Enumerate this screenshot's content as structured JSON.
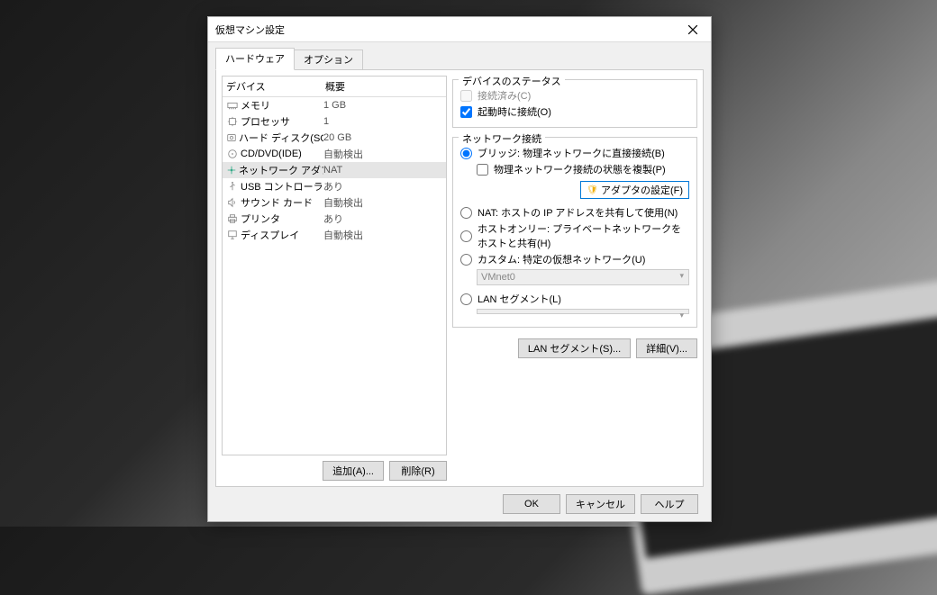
{
  "title": "仮想マシン設定",
  "tabs": {
    "hardware": "ハードウェア",
    "options": "オプション"
  },
  "deviceList": {
    "headers": {
      "device": "デバイス",
      "summary": "概要"
    },
    "rows": [
      {
        "icon": "memory",
        "device": "メモリ",
        "summary": "1 GB"
      },
      {
        "icon": "cpu",
        "device": "プロセッサ",
        "summary": "1"
      },
      {
        "icon": "hdd",
        "device": "ハード ディスク(SCSI)",
        "summary": "20 GB"
      },
      {
        "icon": "cd",
        "device": "CD/DVD(IDE)",
        "summary": "自動検出"
      },
      {
        "icon": "nic",
        "device": "ネットワーク アダプタ",
        "summary": "NAT"
      },
      {
        "icon": "usb",
        "device": "USB コントローラ",
        "summary": "あり"
      },
      {
        "icon": "sound",
        "device": "サウンド カード",
        "summary": "自動検出"
      },
      {
        "icon": "printer",
        "device": "プリンタ",
        "summary": "あり"
      },
      {
        "icon": "display",
        "device": "ディスプレイ",
        "summary": "自動検出"
      }
    ]
  },
  "selectedIndex": 4,
  "hwButtons": {
    "add": "追加(A)...",
    "remove": "削除(R)"
  },
  "statusGroup": {
    "title": "デバイスのステータス",
    "connected": "接続済み(C)",
    "connectAtPowerOn": "起動時に接続(O)"
  },
  "netGroup": {
    "title": "ネットワーク接続",
    "bridged": "ブリッジ: 物理ネットワークに直接接続(B)",
    "replicate": "物理ネットワーク接続の状態を複製(P)",
    "adapterSettings": "アダプタの設定(F)",
    "nat": "NAT: ホストの IP アドレスを共有して使用(N)",
    "hostOnly": "ホストオンリー: プライベートネットワークをホストと共有(H)",
    "custom": "カスタム: 特定の仮想ネットワーク(U)",
    "customValue": "VMnet0",
    "lanSegment": "LAN セグメント(L)",
    "lanValue": "",
    "lanSegmentsBtn": "LAN セグメント(S)...",
    "advancedBtn": "詳細(V)..."
  },
  "footer": {
    "ok": "OK",
    "cancel": "キャンセル",
    "help": "ヘルプ"
  }
}
